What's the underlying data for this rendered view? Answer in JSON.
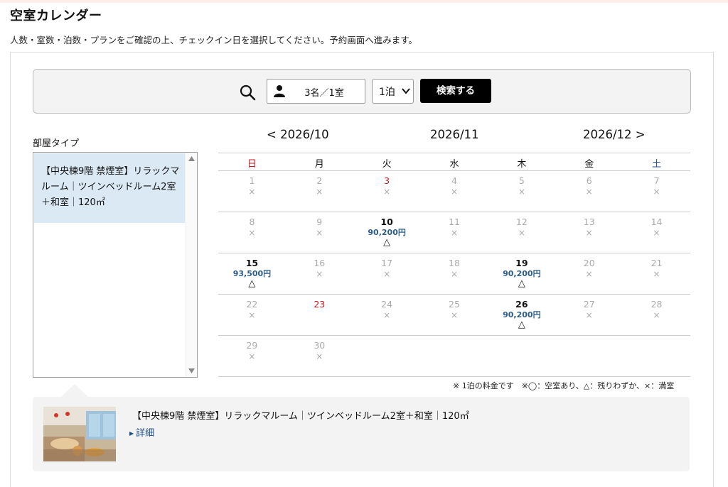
{
  "header": {
    "title": "空室カレンダー",
    "subtitle": "人数・室数・泊数・プランをご確認の上、チェックイン日を選択してください。予約画面へ進みます。"
  },
  "search": {
    "guests": "3名／1室",
    "nights": "1泊",
    "button": "検索する"
  },
  "room_types": {
    "label": "部屋タイプ",
    "items": [
      {
        "text": "【中央棟9階 禁煙室】リラックマルーム｜ツインベッドルーム2室＋和室｜120㎡"
      }
    ]
  },
  "calendar": {
    "prev": "< 2026/10",
    "current": "2026/11",
    "next": "2026/12 >",
    "weekdays": [
      "日",
      "月",
      "火",
      "水",
      "木",
      "金",
      "土"
    ],
    "weekday_colors": [
      "#c8161d",
      "#111111",
      "#111111",
      "#111111",
      "#111111",
      "#111111",
      "#1f4e8c"
    ],
    "weeks": [
      [
        {
          "day": "1",
          "mark": "×"
        },
        {
          "day": "2",
          "mark": "×"
        },
        {
          "day": "3",
          "mark": "×",
          "holiday": true
        },
        {
          "day": "4",
          "mark": "×"
        },
        {
          "day": "5",
          "mark": "×"
        },
        {
          "day": "6",
          "mark": "×"
        },
        {
          "day": "7",
          "mark": "×"
        }
      ],
      [
        {
          "day": "8",
          "mark": "×"
        },
        {
          "day": "9",
          "mark": "×"
        },
        {
          "day": "10",
          "price": "90,200円",
          "mark": "△"
        },
        {
          "day": "11",
          "mark": "×"
        },
        {
          "day": "12",
          "mark": "×"
        },
        {
          "day": "13",
          "mark": "×"
        },
        {
          "day": "14",
          "mark": "×"
        }
      ],
      [
        {
          "day": "15",
          "price": "93,500円",
          "mark": "△"
        },
        {
          "day": "16",
          "mark": "×"
        },
        {
          "day": "17",
          "mark": "×"
        },
        {
          "day": "18",
          "mark": "×"
        },
        {
          "day": "19",
          "price": "90,200円",
          "mark": "△"
        },
        {
          "day": "20",
          "mark": "×"
        },
        {
          "day": "21",
          "mark": "×"
        }
      ],
      [
        {
          "day": "22",
          "mark": "×"
        },
        {
          "day": "23",
          "holiday": true
        },
        {
          "day": "24",
          "mark": "×"
        },
        {
          "day": "25",
          "mark": "×"
        },
        {
          "day": "26",
          "price": "90,200円",
          "mark": "△"
        },
        {
          "day": "27",
          "mark": "×"
        },
        {
          "day": "28",
          "mark": "×"
        }
      ],
      [
        {
          "day": "29",
          "mark": "×"
        },
        {
          "day": "30",
          "mark": "×"
        }
      ]
    ],
    "legend": "※ 1泊の料金です　※◯：空室あり、△：残りわずか、×：満室"
  },
  "room_detail": {
    "title": "【中央棟9階 禁煙室】リラックマルーム｜ツインベッドルーム2室＋和室｜120㎡",
    "link": "詳細"
  }
}
